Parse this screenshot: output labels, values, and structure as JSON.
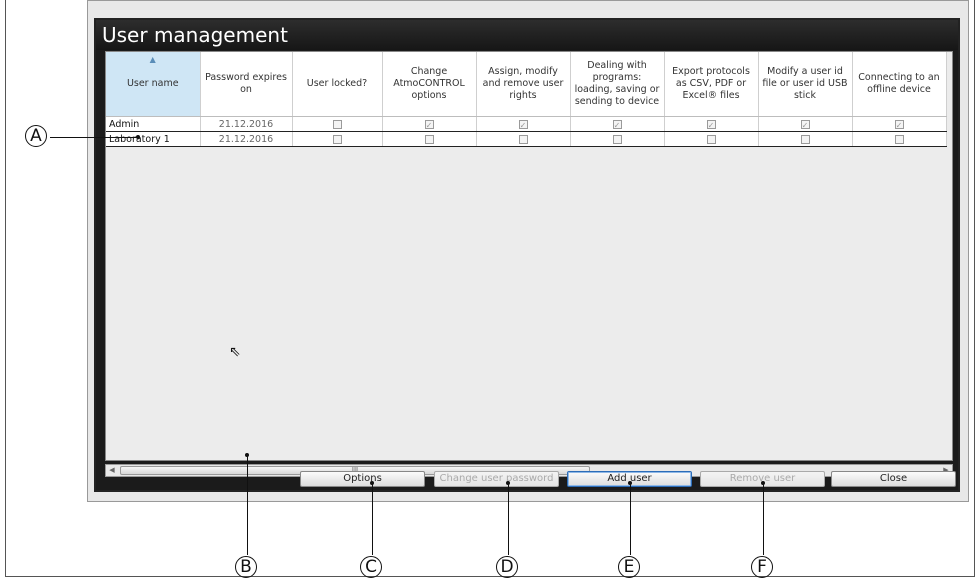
{
  "window": {
    "title": "User management"
  },
  "table": {
    "columns": [
      {
        "label": "User name",
        "width": 94
      },
      {
        "label": "Password expires on",
        "width": 92
      },
      {
        "label": "User locked?",
        "width": 90
      },
      {
        "label": "Change AtmoCONTROL options",
        "width": 94
      },
      {
        "label": "Assign, modify and remove user rights",
        "width": 94
      },
      {
        "label": "Dealing with programs: loading, saving or sending to device",
        "width": 94
      },
      {
        "label": "Export protocols as CSV, PDF or Excel® files",
        "width": 94
      },
      {
        "label": "Modify a user id file or user id USB stick",
        "width": 94
      },
      {
        "label": "Connecting to an offline device",
        "width": 94
      }
    ],
    "sort_column": "User name",
    "rows": [
      {
        "name": "Admin",
        "expires": "21.12.2016",
        "checks": [
          false,
          true,
          true,
          true,
          true,
          true,
          true
        ]
      },
      {
        "name": "Laboratory 1",
        "expires": "21.12.2016",
        "checks": [
          false,
          false,
          false,
          false,
          false,
          false,
          false
        ]
      }
    ]
  },
  "scrollbar": {
    "thumb_grip": "III"
  },
  "buttons": {
    "options": "Options",
    "change_password": "Change user password",
    "add_user": "Add user",
    "remove_user": "Remove user",
    "close": "Close"
  },
  "callouts": [
    "A",
    "B",
    "C",
    "D",
    "E",
    "F"
  ]
}
